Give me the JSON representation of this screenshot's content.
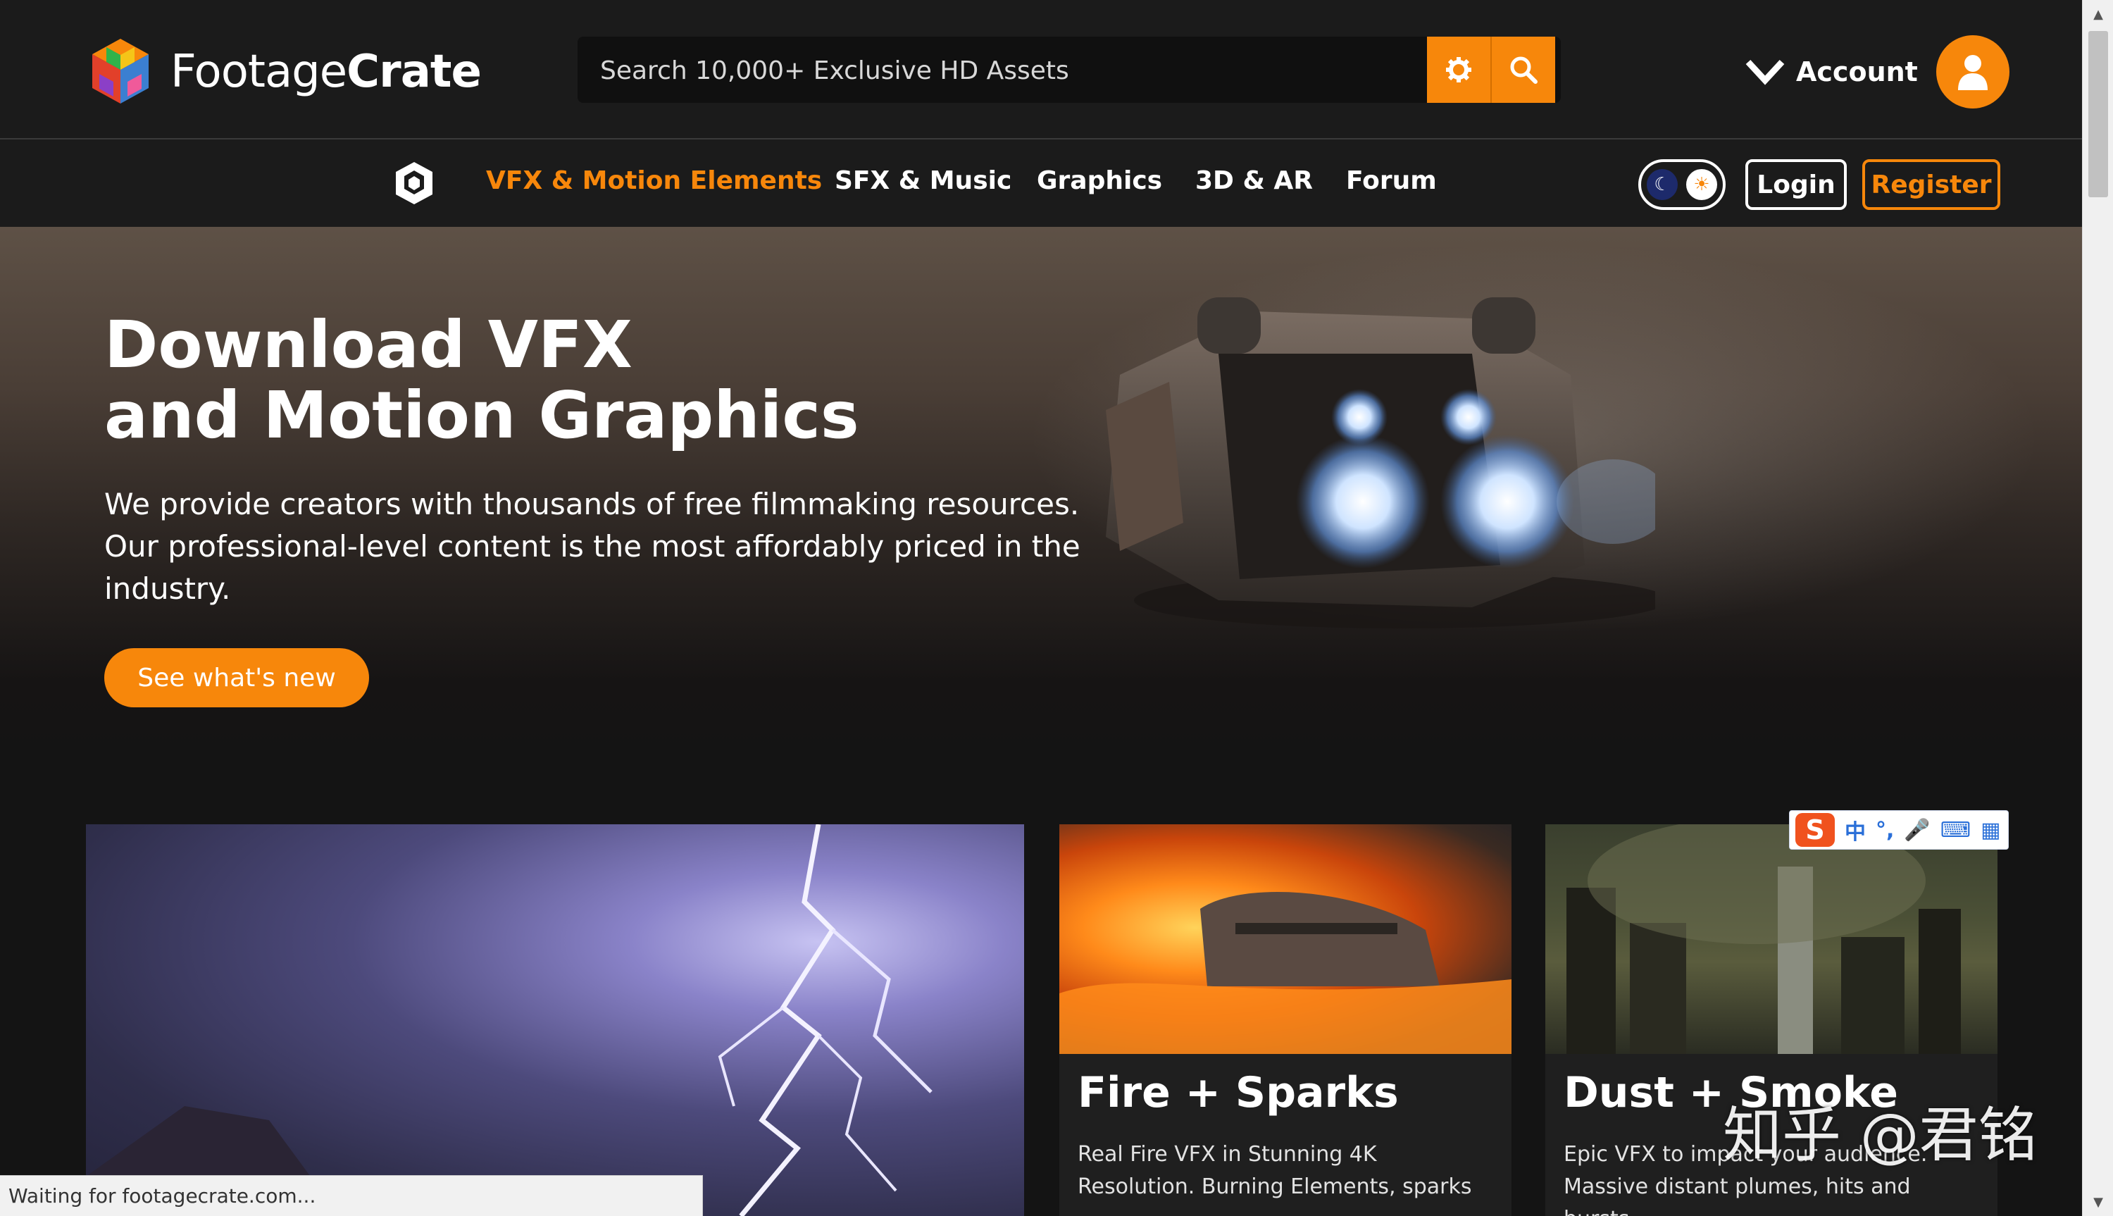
{
  "header": {
    "logo_text_light": "Footage",
    "logo_text_bold": "Crate",
    "search_placeholder": "Search 10,000+ Exclusive HD Assets",
    "settings_icon": "gear-icon",
    "search_icon": "search-icon",
    "account_label": "Account"
  },
  "nav": {
    "items": [
      {
        "label": "VFX & Motion Elements",
        "active": true
      },
      {
        "label": "SFX & Music",
        "active": false
      },
      {
        "label": "Graphics",
        "active": false
      },
      {
        "label": "3D & AR",
        "active": false
      },
      {
        "label": "Forum",
        "active": false
      }
    ],
    "login_label": "Login",
    "register_label": "Register"
  },
  "hero": {
    "title_line1": "Download VFX",
    "title_line2": "and Motion Graphics",
    "text": "We provide creators with thousands of free filmmaking resources. Our professional-level content is the most affordably priced in the industry.",
    "cta_label": "See what's new"
  },
  "cards": [
    {
      "title": "",
      "desc": ""
    },
    {
      "title": "Fire + Sparks",
      "desc": "Real Fire VFX in Stunning 4K Resolution. Burning Elements, sparks"
    },
    {
      "title": "Dust + Smoke",
      "desc": "Epic VFX to impact your audience. Massive distant plumes, hits and bursts,"
    }
  ],
  "browser": {
    "status_text": "Waiting for footagecrate.com..."
  },
  "ime": {
    "logo": "S",
    "items": [
      "中",
      "°,",
      "🎤",
      "⌨",
      "▦"
    ]
  },
  "watermark": "知乎 @君铭",
  "colors": {
    "accent": "#f7870b",
    "background": "#141414",
    "bar": "#1b1b1b"
  }
}
